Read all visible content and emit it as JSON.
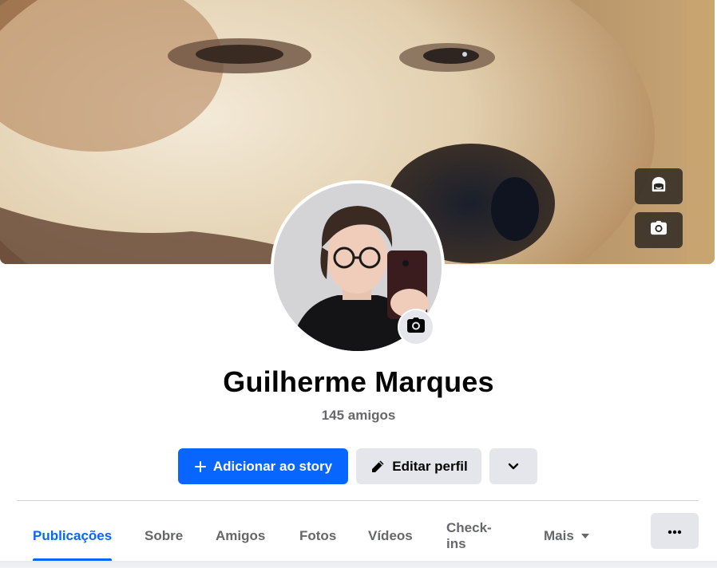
{
  "profile": {
    "name": "Guilherme Marques",
    "friends": "145 amigos"
  },
  "actions": {
    "add_story_label": "Adicionar ao story",
    "edit_profile_label": "Editar perfil"
  },
  "tabs": [
    {
      "label": "Publicações",
      "active": true
    },
    {
      "label": "Sobre"
    },
    {
      "label": "Amigos"
    },
    {
      "label": "Fotos"
    },
    {
      "label": "Vídeos"
    },
    {
      "label": "Check-ins"
    },
    {
      "label": "Mais"
    }
  ],
  "icons": {
    "cover_avatar_button": "avatar-sticker-icon",
    "cover_camera_button": "camera-icon",
    "profile_camera_button": "camera-icon",
    "add_story": "plus-icon",
    "edit_profile": "pencil-icon",
    "expand": "chevron-down-icon",
    "more_tab": "caret-down-icon",
    "tab_menu": "ellipsis-icon"
  },
  "colors": {
    "accent": "#0866ff",
    "secondary_button": "#e4e6eb",
    "muted_text": "#65676b",
    "text": "#050505"
  }
}
